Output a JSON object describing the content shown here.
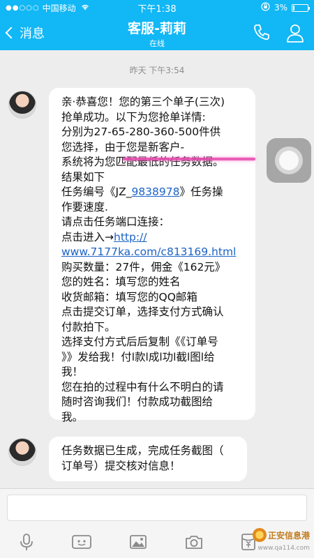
{
  "status_bar": {
    "carrier": "中国移动",
    "time": "下午1:38",
    "battery": "3%"
  },
  "nav": {
    "back_label": "消息",
    "title": "客服-莉莉",
    "subtitle": "在线"
  },
  "chat": {
    "timestamp": "昨天 下午3:54",
    "msg1": {
      "l1": "亲·恭喜您！您的第三个单子(三次)",
      "l2": "抢单成功。以下为您抢单详情:",
      "l3": "分别为27-65-280-360-500件供",
      "l4": "您选择，由于您是新客户-",
      "l5": "系统将为您匹配最低的任务数据。",
      "l6": "结果如下",
      "l7a": "任务编号《JZ_",
      "l7num": "9838978",
      "l7b": "》任务操",
      "l8": "作要速度.",
      "l9": "请点击任务端口连接：",
      "l10a": "点击进入→",
      "l10link": "http://",
      "l11link": "www.7177ka.com/c813169.html",
      "l12": "购买数量：27件，佣金《162元》",
      "l13": "您的姓名：填写您的姓名",
      "l14": "收货邮箱：填写您的QQ邮箱",
      "l15": "点击提交订单，选择支付方式确认",
      "l16": "付款拍下。",
      "l17": "选择支付方式后后复制《《订单号",
      "l18": "》》发给我！付l款l成l功l截l图l给",
      "l19": "我！",
      "l20": "您在拍的过程中有什么不明白的请",
      "l21": "随时咨询我们！付款成功截图给",
      "l22": "我。"
    },
    "msg2": {
      "l1": "任务数据已生成，完成任务截图（",
      "l2": "订单号）提交核对信息！"
    }
  },
  "toolbar": {
    "icons": [
      "microphone-icon",
      "video-icon",
      "image-icon",
      "camera-icon",
      "red-packet-icon"
    ]
  },
  "watermark": {
    "text": "正安信息港",
    "url": "www.qa114.com"
  },
  "colors": {
    "nav_bg": "#12b7f5",
    "chat_bg": "#ededed",
    "link": "#1c63c7",
    "highlight": "#e64cb0"
  }
}
